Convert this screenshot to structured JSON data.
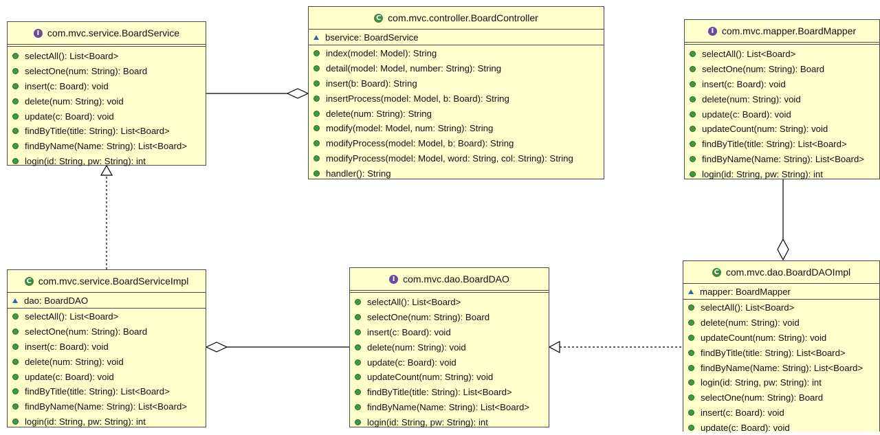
{
  "classes": {
    "board_service": {
      "kind": "interface",
      "title": "com.mvc.service.BoardService",
      "fields": [],
      "methods": [
        "selectAll(): List<Board>",
        "selectOne(num: String): Board",
        "insert(c: Board): void",
        "delete(num: String): void",
        "update(c: Board): void",
        "findByTitle(title: String): List<Board>",
        "findByName(Name: String): List<Board>",
        "login(id: String, pw: String): int"
      ]
    },
    "board_controller": {
      "kind": "class",
      "title": "com.mvc.controller.BoardController",
      "fields": [
        "bservice: BoardService"
      ],
      "methods": [
        "index(model: Model): String",
        "detail(model: Model, number: String): String",
        "insert(b: Board): String",
        "insertProcess(model: Model, b: Board): String",
        "delete(num: String): String",
        "modify(model: Model, num: String): String",
        "modifyProcess(model: Model, b: Board): String",
        "modifyProcess(model: Model, word: String, col: String): String",
        "handler(): String"
      ]
    },
    "board_mapper": {
      "kind": "interface",
      "title": "com.mvc.mapper.BoardMapper",
      "fields": [],
      "methods": [
        "selectAll(): List<Board>",
        "selectOne(num: String): Board",
        "insert(c: Board): void",
        "delete(num: String): void",
        "update(c: Board): void",
        "updateCount(num: String): void",
        "findByTitle(title: String): List<Board>",
        "findByName(Name: String): List<Board>",
        "login(id: String, pw: String): int"
      ]
    },
    "board_service_impl": {
      "kind": "class",
      "title": "com.mvc.service.BoardServiceImpl",
      "fields": [
        "dao: BoardDAO"
      ],
      "methods": [
        "selectAll(): List<Board>",
        "selectOne(num: String): Board",
        "insert(c: Board): void",
        "delete(num: String): void",
        "update(c: Board): void",
        "findByTitle(title: String): List<Board>",
        "findByName(Name: String): List<Board>",
        "login(id: String, pw: String): int"
      ]
    },
    "board_dao": {
      "kind": "interface",
      "title": "com.mvc.dao.BoardDAO",
      "fields": [],
      "methods": [
        "selectAll(): List<Board>",
        "selectOne(num: String): Board",
        "insert(c: Board): void",
        "delete(num: String): void",
        "update(c: Board): void",
        "updateCount(num: String): void",
        "findByTitle(title: String): List<Board>",
        "findByName(Name: String): List<Board>",
        "login(id: String, pw: String): int"
      ]
    },
    "board_dao_impl": {
      "kind": "class",
      "title": "com.mvc.dao.BoardDAOImpl",
      "fields": [
        "mapper: BoardMapper"
      ],
      "methods": [
        "selectAll(): List<Board>",
        "delete(num: String): void",
        "updateCount(num: String): void",
        "findByTitle(title: String): List<Board>",
        "findByName(Name: String): List<Board>",
        "login(id: String, pw: String): int",
        "selectOne(num: String): Board",
        "insert(c: Board): void",
        "update(c: Board): void"
      ]
    }
  },
  "relations": [
    {
      "type": "aggregation",
      "whole": "board_controller",
      "part": "board_service"
    },
    {
      "type": "realization",
      "from": "board_service_impl",
      "to": "board_service"
    },
    {
      "type": "aggregation",
      "whole": "board_service_impl",
      "part": "board_dao"
    },
    {
      "type": "realization",
      "from": "board_dao_impl",
      "to": "board_dao"
    },
    {
      "type": "aggregation",
      "whole": "board_dao_impl",
      "part": "board_mapper"
    }
  ],
  "colors": {
    "box_fill": "#fffecd",
    "interface_badge": "#6d4aa0",
    "class_badge": "#3f8a3f",
    "method_icon": "#3f9a3f",
    "field_icon": "#2f6aa8"
  }
}
